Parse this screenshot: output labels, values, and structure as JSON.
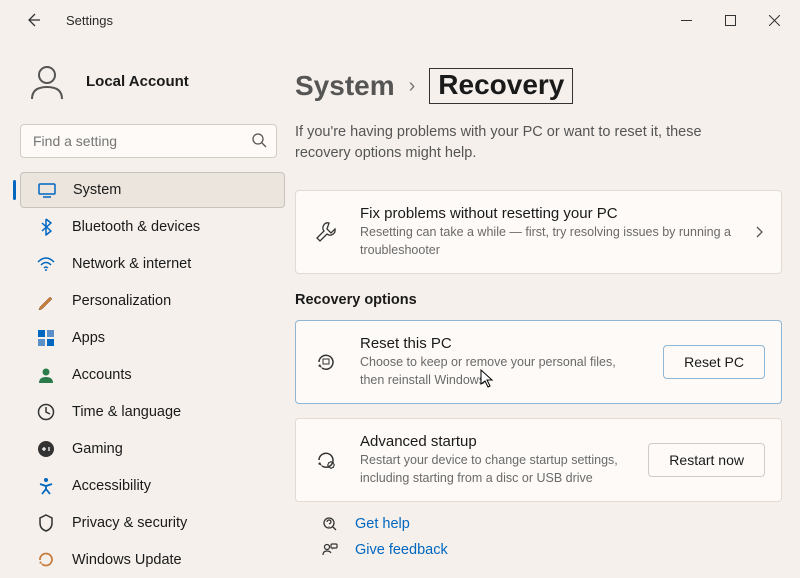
{
  "window": {
    "title": "Settings"
  },
  "account": {
    "name": "Local Account"
  },
  "search": {
    "placeholder": "Find a setting"
  },
  "sidebar": {
    "items": [
      {
        "label": "System"
      },
      {
        "label": "Bluetooth & devices"
      },
      {
        "label": "Network & internet"
      },
      {
        "label": "Personalization"
      },
      {
        "label": "Apps"
      },
      {
        "label": "Accounts"
      },
      {
        "label": "Time & language"
      },
      {
        "label": "Gaming"
      },
      {
        "label": "Accessibility"
      },
      {
        "label": "Privacy & security"
      },
      {
        "label": "Windows Update"
      }
    ]
  },
  "breadcrumb": {
    "parent": "System",
    "current": "Recovery"
  },
  "intro": "If you're having problems with your PC or want to reset it, these recovery options might help.",
  "fix": {
    "title": "Fix problems without resetting your PC",
    "desc": "Resetting can take a while — first, try resolving issues by running a troubleshooter"
  },
  "recovery": {
    "section_label": "Recovery options",
    "reset": {
      "title": "Reset this PC",
      "desc": "Choose to keep or remove your personal files, then reinstall Windows",
      "button": "Reset PC"
    },
    "advanced": {
      "title": "Advanced startup",
      "desc": "Restart your device to change startup settings, including starting from a disc or USB drive",
      "button": "Restart now"
    }
  },
  "footer": {
    "help": "Get help",
    "feedback": "Give feedback"
  }
}
